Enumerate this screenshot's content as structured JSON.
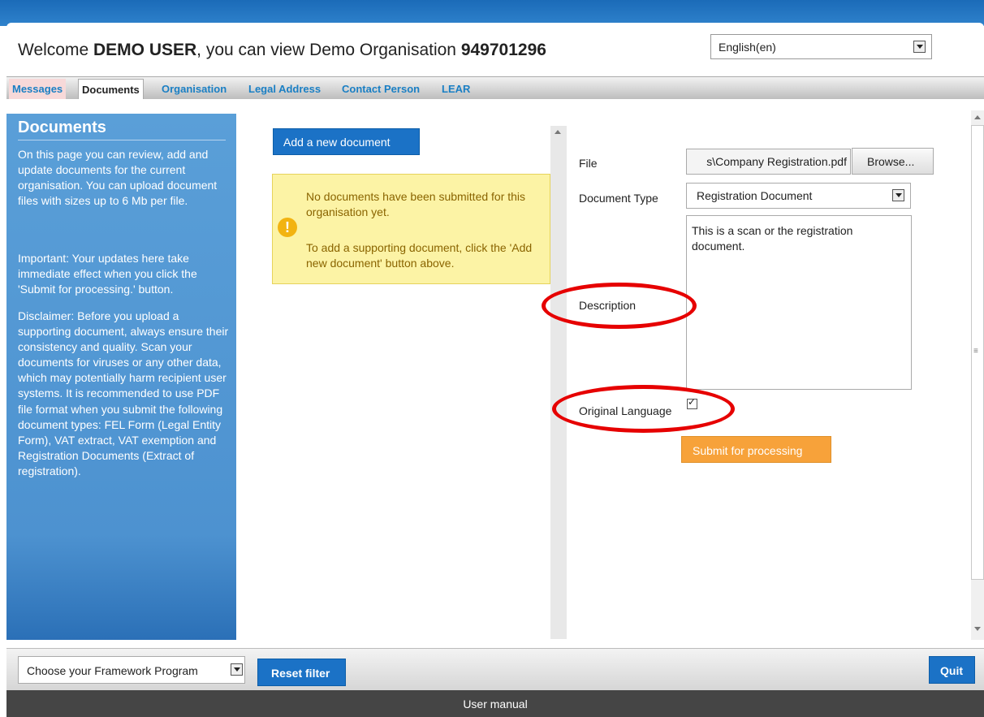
{
  "header": {
    "welcome_prefix": "Welcome ",
    "user": "DEMO USER",
    "welcome_middle": ", you can view Demo Organisation ",
    "org_id": "949701296",
    "language": "English(en)"
  },
  "tabs": [
    {
      "label": "Messages"
    },
    {
      "label": "Documents"
    },
    {
      "label": "Organisation"
    },
    {
      "label": "Legal Address"
    },
    {
      "label": "Contact Person"
    },
    {
      "label": "LEAR"
    }
  ],
  "sidebar": {
    "title": "Documents",
    "p1": "On this page you can review, add and update documents for the current organisation. You can upload document files with sizes up to 6 Mb per file.",
    "p2": "Important: Your updates here take immediate effect when you click the 'Submit for processing.' button.",
    "p3": "Disclaimer: Before you upload a supporting document, always ensure their consistency and quality. Scan your documents for viruses or any other data, which may potentially harm recipient user systems. It is recommended to use PDF file format when you submit the following document types: FEL Form (Legal Entity Form), VAT extract, VAT exemption and Registration Documents (Extract of registration)."
  },
  "main": {
    "add_button": "Add a new document",
    "notice_line1": "No documents have been submitted for this organisation yet.",
    "notice_line2": "To add a supporting document, click the 'Add new document' button above."
  },
  "form": {
    "file_label": "File",
    "file_value": "s\\Company Registration.pdf",
    "browse": "Browse...",
    "doctype_label": "Document Type",
    "doctype_value": "Registration Document",
    "description_label": "Description",
    "description_value": "This is a scan or the registration document.",
    "orig_lang_label": "Original Language",
    "orig_lang_checked": true,
    "submit": "Submit for processing"
  },
  "bottom": {
    "framework_select": "Choose your Framework Program",
    "reset": "Reset filter",
    "quit": "Quit"
  },
  "footer": {
    "link": "User manual"
  },
  "colors": {
    "primary_blue": "#1b72c6",
    "sidebar_blue": "#5a9fd8",
    "submit_orange": "#f7a23a",
    "notice_yellow": "#fcf3a5",
    "annotation_red": "#e60000"
  }
}
